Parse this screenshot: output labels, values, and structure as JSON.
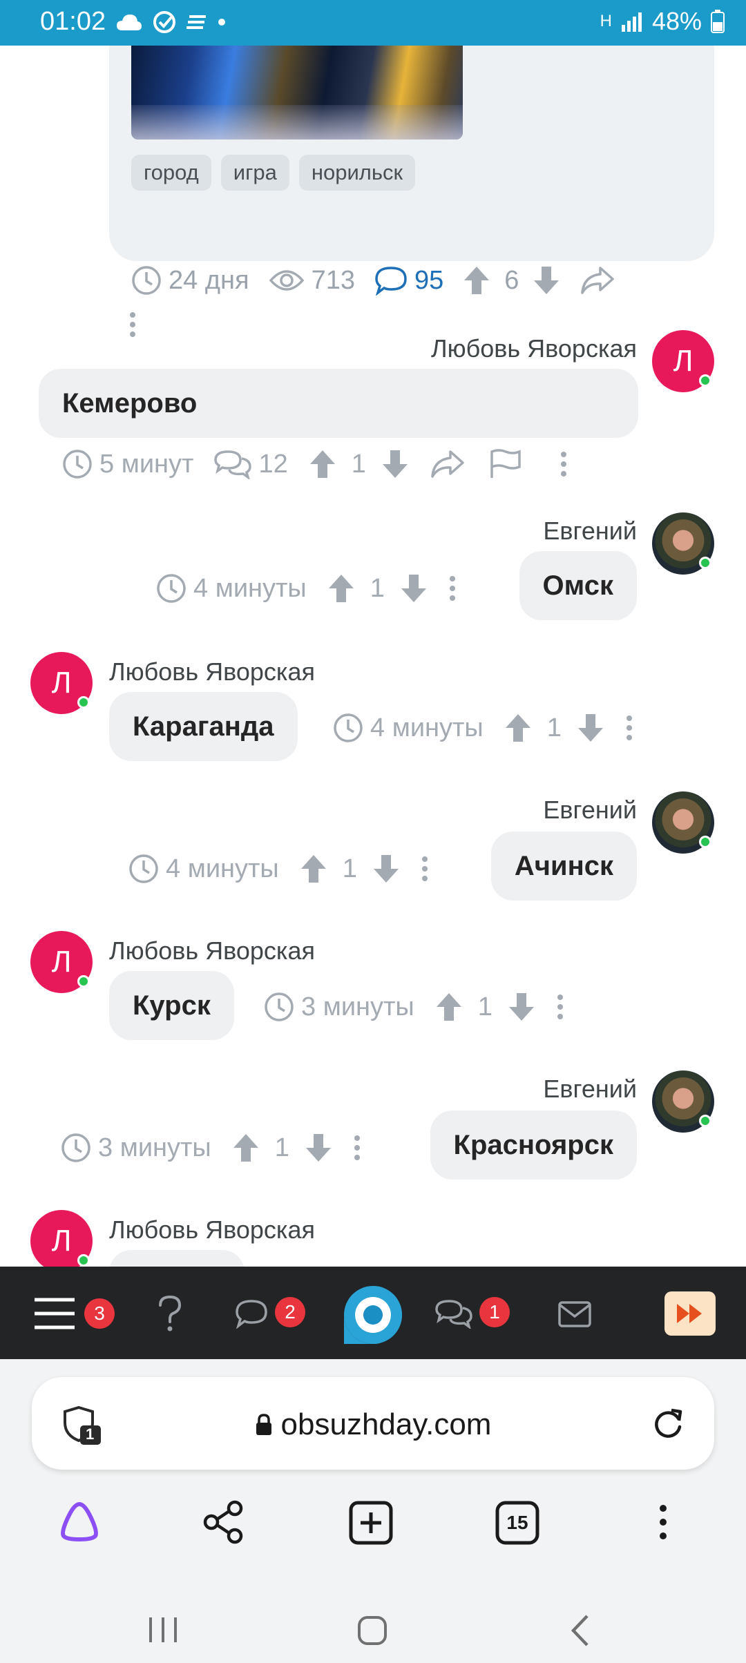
{
  "status_bar": {
    "time": "01:02",
    "battery": "48%",
    "network": "H"
  },
  "post": {
    "tags": [
      "город",
      "игра",
      "норильск"
    ],
    "age": "24 дня",
    "views": "713",
    "comments": "95",
    "rating": "6"
  },
  "comments": [
    {
      "author": "Любовь Яворская",
      "text": "Кемерово",
      "time": "5 минут",
      "replies": "12",
      "rating": "1",
      "avatar_letter": "Л"
    },
    {
      "author": "Евгений",
      "text": "Омск",
      "time": "4 минуты",
      "rating": "1"
    },
    {
      "author": "Любовь Яворская",
      "text": "Караганда",
      "time": "4 минуты",
      "rating": "1",
      "avatar_letter": "Л"
    },
    {
      "author": "Евгений",
      "text": "Ачинск",
      "time": "4 минуты",
      "rating": "1"
    },
    {
      "author": "Любовь Яворская",
      "text": "Курск",
      "time": "3 минуты",
      "rating": "1",
      "avatar_letter": "Л"
    },
    {
      "author": "Евгений",
      "text": "Красноярск",
      "time": "3 минуты",
      "rating": "1"
    },
    {
      "author": "Любовь Яворская",
      "avatar_letter": "Л"
    }
  ],
  "site_nav": {
    "menu_badge": "3",
    "messages_badge": "2",
    "discussions_badge": "1"
  },
  "browser": {
    "url": "obsuzhday.com",
    "tabs_count": "15",
    "shield_count": "1"
  },
  "colors": {
    "status_bar": "#1a9bc9",
    "avatar_pink": "#e8195b",
    "link_blue": "#1d6fb8",
    "badge_red": "#e9353e",
    "nav_dark": "#232426",
    "alice_purple": "#8c4ef5"
  },
  "icons": [
    "clock-icon",
    "eye-icon",
    "comment-icon",
    "arrow-up-icon",
    "arrow-down-icon",
    "share-icon",
    "flag-icon",
    "more-vertical-icon",
    "menu-icon",
    "question-icon",
    "chat-icon",
    "discussions-icon",
    "mail-icon",
    "fast-forward-icon",
    "lock-icon",
    "reload-icon",
    "alice-icon",
    "add-tab-icon",
    "tabs-icon"
  ]
}
